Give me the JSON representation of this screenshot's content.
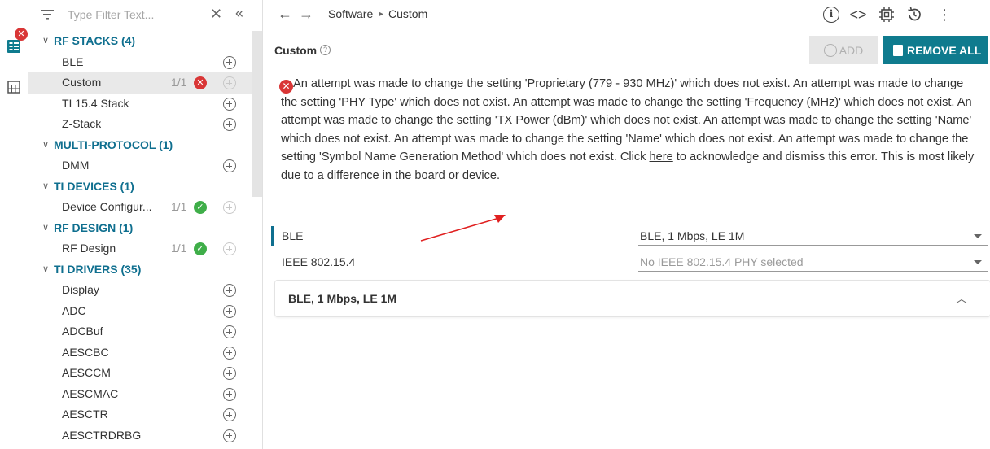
{
  "rail": {
    "badge": "✕"
  },
  "filter": {
    "placeholder": "Type Filter Text...",
    "clear_glyph": "✕",
    "collapse_glyph": "«"
  },
  "tree": [
    {
      "type": "category",
      "label": "RF STACKS (4)"
    },
    {
      "type": "item",
      "label": "BLE"
    },
    {
      "type": "item",
      "label": "Custom",
      "count": "1/1",
      "status": "error",
      "selected": true
    },
    {
      "type": "item",
      "label": "TI 15.4 Stack"
    },
    {
      "type": "item",
      "label": "Z-Stack"
    },
    {
      "type": "category",
      "label": "MULTI-PROTOCOL (1)"
    },
    {
      "type": "item",
      "label": "DMM"
    },
    {
      "type": "category",
      "label": "TI DEVICES (1)"
    },
    {
      "type": "item",
      "label": "Device Configur...",
      "count": "1/1",
      "status": "ok"
    },
    {
      "type": "category",
      "label": "RF DESIGN (1)"
    },
    {
      "type": "item",
      "label": "RF Design",
      "count": "1/1",
      "status": "ok"
    },
    {
      "type": "category",
      "label": "TI DRIVERS (35)"
    },
    {
      "type": "item",
      "label": "Display"
    },
    {
      "type": "item",
      "label": "ADC"
    },
    {
      "type": "item",
      "label": "ADCBuf"
    },
    {
      "type": "item",
      "label": "AESCBC"
    },
    {
      "type": "item",
      "label": "AESCCM"
    },
    {
      "type": "item",
      "label": "AESCMAC"
    },
    {
      "type": "item",
      "label": "AESCTR"
    },
    {
      "type": "item",
      "label": "AESCTRDRBG"
    }
  ],
  "topbar": {
    "breadcrumb": [
      "Software",
      "Custom"
    ]
  },
  "panel": {
    "title": "Custom",
    "add_label": "ADD",
    "remove_all_label": "REMOVE ALL",
    "error": {
      "text_before": "An attempt was made to change the setting 'Proprietary (779 - 930 MHz)' which does not exist. An attempt was made to change the setting 'PHY Type' which does not exist. An attempt was made to change the setting 'Frequency (MHz)' which does not exist. An attempt was made to change the setting 'TX Power (dBm)' which does not exist. An attempt was made to change the setting 'Name' which does not exist. An attempt was made to change the setting 'Name' which does not exist. An attempt was made to change the setting 'Symbol Name Generation Method' which does not exist. Click ",
      "link": "here",
      "text_after": " to acknowledge and dismiss this error. This is most likely due to a difference in the board or device."
    },
    "properties": [
      {
        "label": "BLE",
        "value": "BLE, 1 Mbps, LE 1M",
        "muted": false,
        "active": true
      },
      {
        "label": "IEEE 802.15.4",
        "value": "No IEEE 802.15.4 PHY selected",
        "muted": true,
        "active": false
      }
    ],
    "accordion_title": "BLE, 1 Mbps, LE 1M"
  },
  "colors": {
    "accent": "#0f7b8e",
    "error": "#d93636",
    "ok": "#3fae49"
  }
}
